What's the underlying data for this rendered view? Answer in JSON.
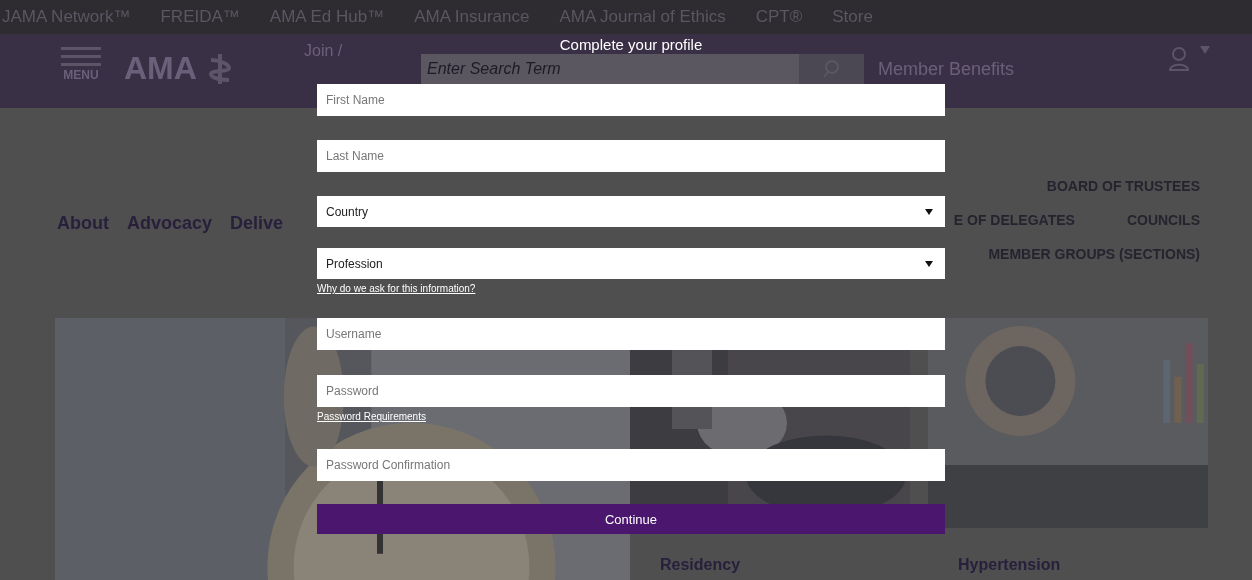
{
  "top_links": [
    "JAMA Network™",
    "FREIDA™",
    "AMA Ed Hub™",
    "AMA Insurance",
    "AMA Journal of Ethics",
    "CPT®",
    "Store"
  ],
  "header": {
    "menu_label": "MENU",
    "logo": "AMA",
    "join": "Join /",
    "search": {
      "placeholder": "Enter Search Term"
    },
    "member_benefits": "Member Benefits"
  },
  "nav": {
    "left": [
      "About",
      "Advocacy",
      "Delive"
    ],
    "right": [
      "BOARD OF TRUSTEES",
      "E OF DELEGATES",
      "COUNCILS",
      "MEMBER GROUPS (SECTIONS)"
    ]
  },
  "cards": [
    {
      "kind": "picture"
    },
    {
      "kind": "picture",
      "caption": "Residency"
    },
    {
      "kind": "picture",
      "caption": "Hypertension"
    }
  ],
  "modal": {
    "title": "Complete your profile",
    "fields": [
      {
        "kind": "text",
        "placeholder": "First Name"
      },
      {
        "kind": "text",
        "placeholder": "Last Name"
      },
      {
        "kind": "select",
        "value": "Country"
      },
      {
        "kind": "select",
        "value": "Profession",
        "link": "Why do we ask for this information?"
      },
      {
        "kind": "text",
        "placeholder": "Username"
      },
      {
        "kind": "password",
        "placeholder": "Password",
        "link": "Password Requirements"
      },
      {
        "kind": "password",
        "placeholder": "Password Confirmation"
      }
    ],
    "button": "Continue"
  }
}
